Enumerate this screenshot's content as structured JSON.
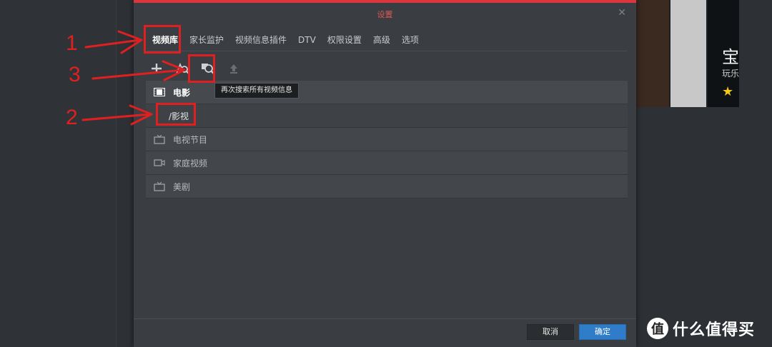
{
  "dialog": {
    "title": "设置",
    "close_icon": "close-icon",
    "tabs": [
      {
        "label": "视频库",
        "active": true
      },
      {
        "label": "家长监护"
      },
      {
        "label": "视频信息插件"
      },
      {
        "label": "DTV"
      },
      {
        "label": "权限设置"
      },
      {
        "label": "高级"
      },
      {
        "label": "选项"
      }
    ],
    "toolbar": {
      "add_icon": "plus-icon",
      "search_icon": "search-icon",
      "rescan_icon": "rescan-icon",
      "upload_icon": "upload-icon"
    },
    "tooltip": "再次搜索所有视频信息",
    "library": [
      {
        "label": "电影",
        "icon": "film-icon",
        "type": "header"
      },
      {
        "label": "/影视",
        "icon": "",
        "type": "sub"
      },
      {
        "label": "电视节目",
        "icon": "tv-icon",
        "type": "item"
      },
      {
        "label": "家庭视频",
        "icon": "video-camera-icon",
        "type": "item"
      },
      {
        "label": "美剧",
        "icon": "tv-icon",
        "type": "item"
      }
    ],
    "buttons": {
      "cancel": "取消",
      "ok": "确定"
    }
  },
  "annotations": {
    "n1": "1",
    "n2": "2",
    "n3": "3",
    "color": "#e02020"
  },
  "background": {
    "right_title": "宝",
    "right_sub": "玩乐",
    "right_star": "★",
    "watermark_logo": "值",
    "watermark_text": "什么值得买"
  }
}
